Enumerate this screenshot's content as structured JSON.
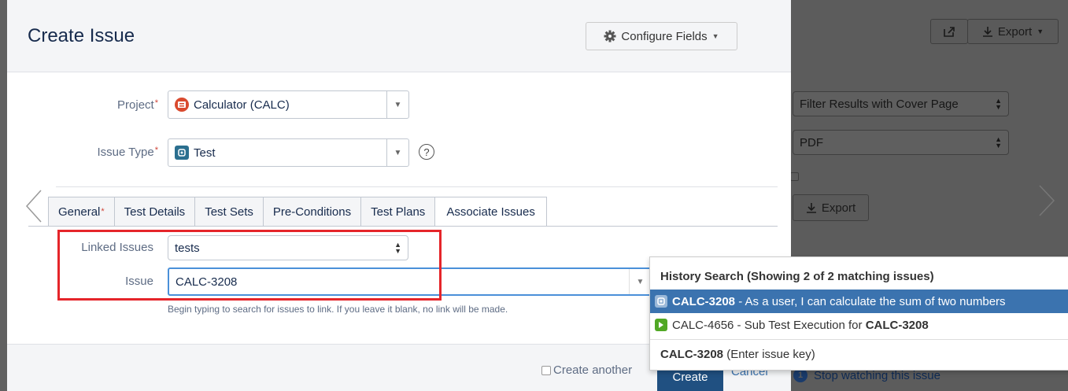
{
  "background": {
    "share_label": "",
    "export_menu_label": "Export",
    "filter_select": "Filter Results with Cover Page",
    "format_select": "PDF",
    "export_button": "Export",
    "watch_count": "1",
    "watch_label": "Stop watching this issue"
  },
  "modal": {
    "title": "Create Issue",
    "configure_fields": "Configure Fields",
    "project_label": "Project",
    "project_value": "Calculator (CALC)",
    "issue_type_label": "Issue Type",
    "issue_type_value": "Test",
    "required_mark": "*",
    "tabs": [
      {
        "label": "General"
      },
      {
        "label": "Test Details"
      },
      {
        "label": "Test Sets"
      },
      {
        "label": "Pre-Conditions"
      },
      {
        "label": "Test Plans"
      },
      {
        "label": "Associate Issues"
      }
    ],
    "linked_issues_label": "Linked Issues",
    "linked_issues_value": "tests",
    "issue_label": "Issue",
    "issue_value": "CALC-3208",
    "hint": "Begin typing to search for issues to link. If you leave it blank, no link will be made.",
    "create_another": "Create another",
    "create_button": "Create",
    "cancel_link": "Cancel"
  },
  "dropdown": {
    "header": "History Search (Showing 2 of 2 matching issues)",
    "items": [
      {
        "key": "CALC-3208",
        "rest": " - As a user, I can calculate the sum of two numbers"
      },
      {
        "prefix": "CALC-4656 - Sub Test Execution for ",
        "key": "CALC-3208"
      }
    ],
    "enter_key": "CALC-3208",
    "enter_hint": " (Enter issue key)"
  },
  "colors": {
    "accent": "#3b73af",
    "highlight_box": "#e5252a",
    "required": "#d04437"
  }
}
